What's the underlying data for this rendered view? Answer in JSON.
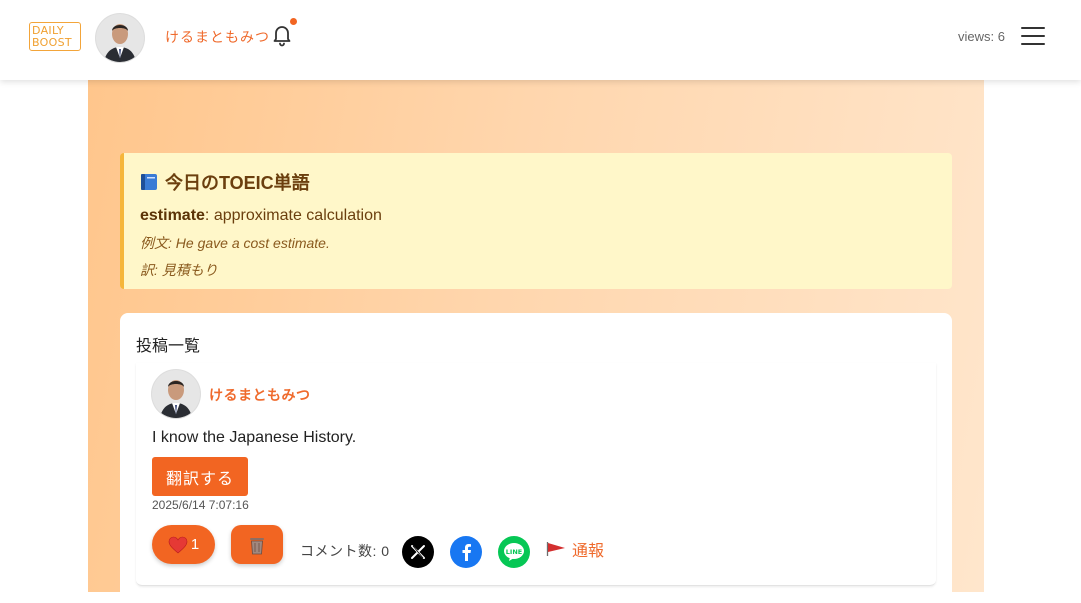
{
  "header": {
    "logo_line1": "DAILY",
    "logo_line2": "BOOST",
    "username": "けるまともみつ",
    "views": "views: 6"
  },
  "word_of_day": {
    "title": "今日のTOEIC単語",
    "word": "estimate",
    "definition": ": approximate calculation",
    "example": "例文: He gave a cost estimate.",
    "translation": "訳: 見積もり"
  },
  "posts": {
    "heading": "投稿一覧",
    "items": [
      {
        "username": "けるまともみつ",
        "content": "I know the Japanese History.",
        "translate_label": "翻訳する",
        "timestamp": "2025/6/14 7:07:16",
        "likes": "1",
        "comment_count": "コメント数: 0",
        "report_label": "通報"
      }
    ]
  },
  "icons": {
    "bell": "bell-icon",
    "menu": "hamburger-menu-icon",
    "like": "heart-icon",
    "delete": "trash-icon",
    "share_x": "x-logo-icon",
    "share_facebook": "facebook-logo-icon",
    "share_line": "line-logo-icon",
    "report": "red-flag-icon"
  },
  "colors": {
    "accent": "#f26522",
    "word_card_bg": "#fff7c9",
    "word_card_border": "#f5b63b",
    "facebook": "#1877f2",
    "line": "#06c755"
  }
}
